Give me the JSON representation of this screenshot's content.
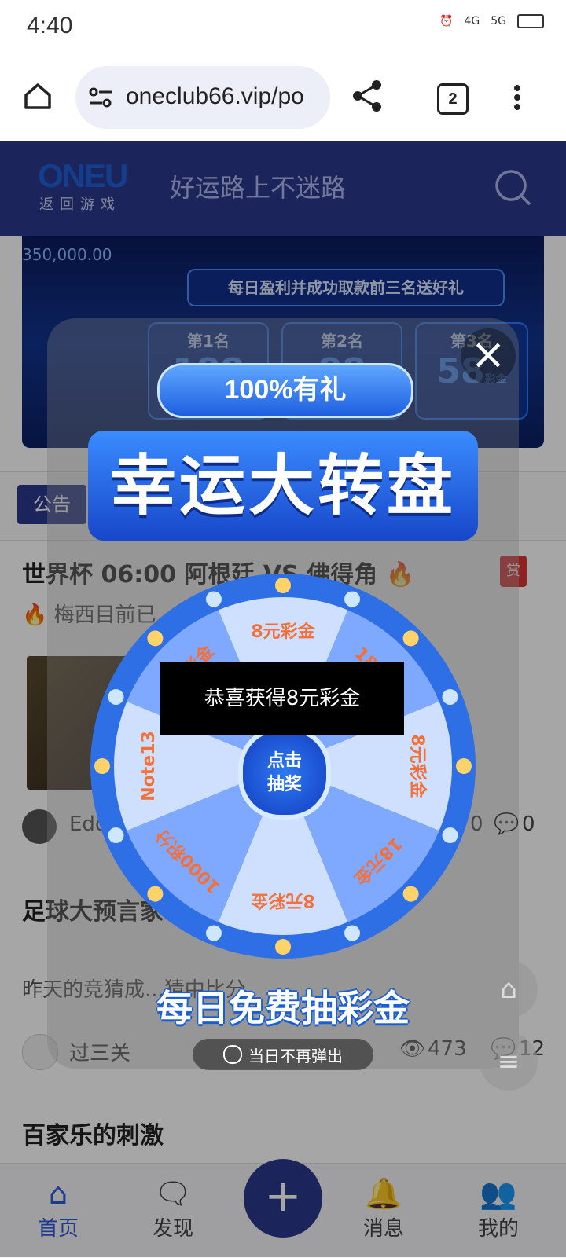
{
  "status_bar": {
    "time": "4:40",
    "signal1": "4G",
    "signal2": "5G"
  },
  "browser": {
    "url": "oneclub66.vip/po",
    "tab_count": "2"
  },
  "header": {
    "logo": "ONEU",
    "logo_sub": "返回游戏",
    "slogan": "好运路上不迷路"
  },
  "banner": {
    "amount": "350,000.00",
    "strip_text": "每日盈利并成功取款前三名送好礼",
    "rank1": "第1名",
    "rank2": "第2名",
    "rank3": "第3名",
    "rank1_value": "188",
    "rank2_value": "88",
    "rank3_value": "58",
    "rank3_unit": "彩金"
  },
  "notice": {
    "badge": "公告"
  },
  "posts": [
    {
      "title": "世界杯 06:00 阿根廷 VS 佛得角 🔥",
      "excerpt": "🔥 梅西目前已...迈进！第 7...",
      "author": "Edo",
      "views": "0",
      "comments": "0"
    },
    {
      "title": "足球大预言家...分竞猜贴之",
      "excerpt": "昨天的竞猜成...猜中比分，",
      "author": "过三关",
      "views": "473",
      "comments": "12"
    },
    {
      "title": "百家乐的刺激"
    }
  ],
  "modal": {
    "gift_pill": "100%有礼",
    "title": "幸运大转盘",
    "center_button_line1": "点击",
    "center_button_line2": "抽奖",
    "toast": "恭喜获得8元彩金",
    "bottom_slogan": "每日免费抽彩金",
    "no_show_label": "当日不再弹出",
    "segments": [
      "8元彩金",
      "18元金",
      "8元彩金",
      "18元金",
      "8元彩金",
      "1000积分",
      "Note13",
      "8元彩金"
    ]
  },
  "nav": {
    "home": "首页",
    "discover": "发现",
    "add": "+",
    "messages": "消息",
    "mine": "我的"
  },
  "reward_label": "赏",
  "colors": {
    "brand": "#2b3a8c",
    "wheel": "#2f6fe6",
    "accent": "#f3703a"
  }
}
